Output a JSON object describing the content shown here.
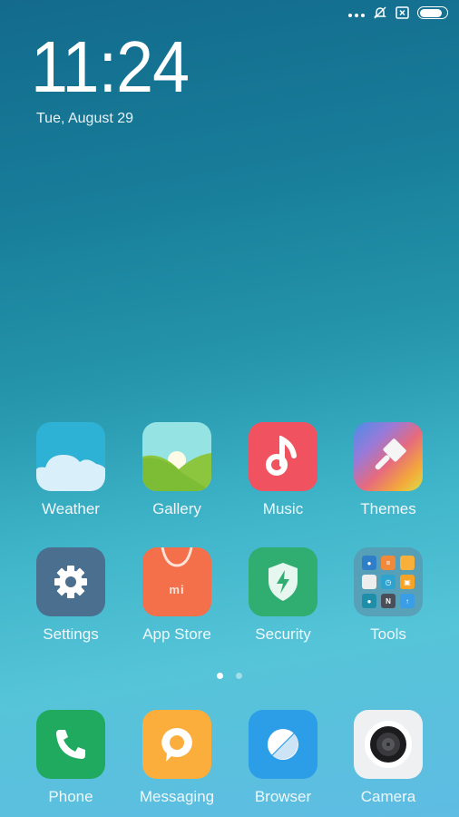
{
  "status_bar": {
    "icons": [
      "more-dots-icon",
      "notifications-muted-icon",
      "sim-off-icon",
      "battery-icon"
    ],
    "battery_level": 0.85
  },
  "lock": {
    "time": "11:24",
    "date": "Tue, August 29"
  },
  "apps": [
    {
      "label": "Weather",
      "icon": "weather-icon",
      "color": "#2db2d6"
    },
    {
      "label": "Gallery",
      "icon": "gallery-icon",
      "color": "#8fe0e0"
    },
    {
      "label": "Music",
      "icon": "music-icon",
      "color": "#f0535f"
    },
    {
      "label": "Themes",
      "icon": "themes-icon",
      "color": "#e26c7a"
    },
    {
      "label": "Settings",
      "icon": "settings-icon",
      "color": "#4b6f8e"
    },
    {
      "label": "App Store",
      "icon": "app-store-icon",
      "color": "#f4704a"
    },
    {
      "label": "Security",
      "icon": "security-icon",
      "color": "#30ad70"
    },
    {
      "label": "Tools",
      "icon": "tools-folder-icon",
      "color": "#5a9cb4"
    }
  ],
  "app_store_badge": "mi",
  "tools_folder": {
    "items": [
      "contacts",
      "notes",
      "files",
      "email",
      "clock",
      "calendar",
      "recorder",
      "notes-n",
      "updater"
    ],
    "n_label": "N"
  },
  "pages": {
    "total": 2,
    "current": 1
  },
  "dock": [
    {
      "label": "Phone",
      "icon": "phone-icon",
      "color": "#1faa5f"
    },
    {
      "label": "Messaging",
      "icon": "messaging-icon",
      "color": "#fbae3c"
    },
    {
      "label": "Browser",
      "icon": "browser-icon",
      "color": "#2c9ee8"
    },
    {
      "label": "Camera",
      "icon": "camera-icon",
      "color": "#eef0f2"
    }
  ]
}
